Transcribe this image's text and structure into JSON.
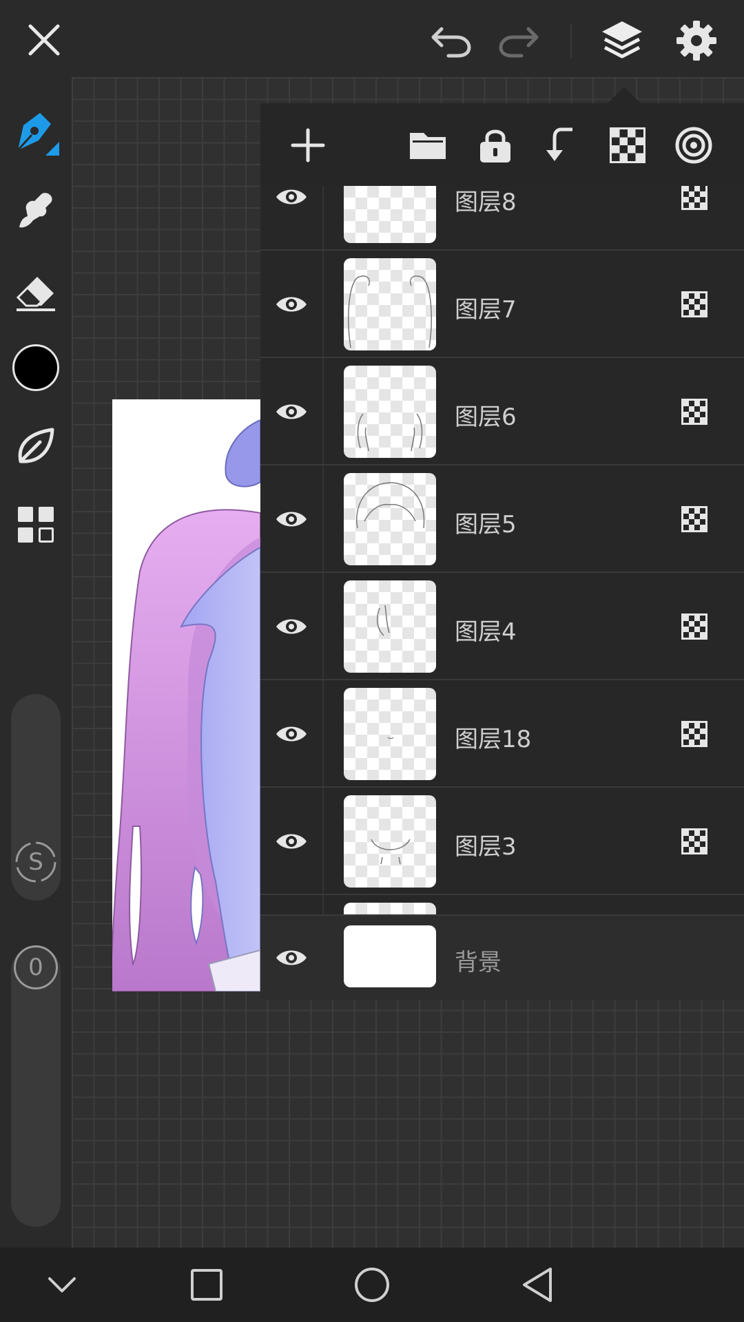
{
  "layer_panel": {
    "layers": [
      {
        "name": "图层8"
      },
      {
        "name": "图层7"
      },
      {
        "name": "图层6"
      },
      {
        "name": "图层5"
      },
      {
        "name": "图层4"
      },
      {
        "name": "图层18"
      },
      {
        "name": "图层3"
      }
    ],
    "background_layer": {
      "name": "背景"
    }
  },
  "left_toolbar": {
    "active_color": "#000000",
    "brush_size_label": "S",
    "opacity_label": "0"
  },
  "colors": {
    "accent": "#1e9be8",
    "bar_bg": "#2a2a2a",
    "icon": "#e8e8e8"
  }
}
